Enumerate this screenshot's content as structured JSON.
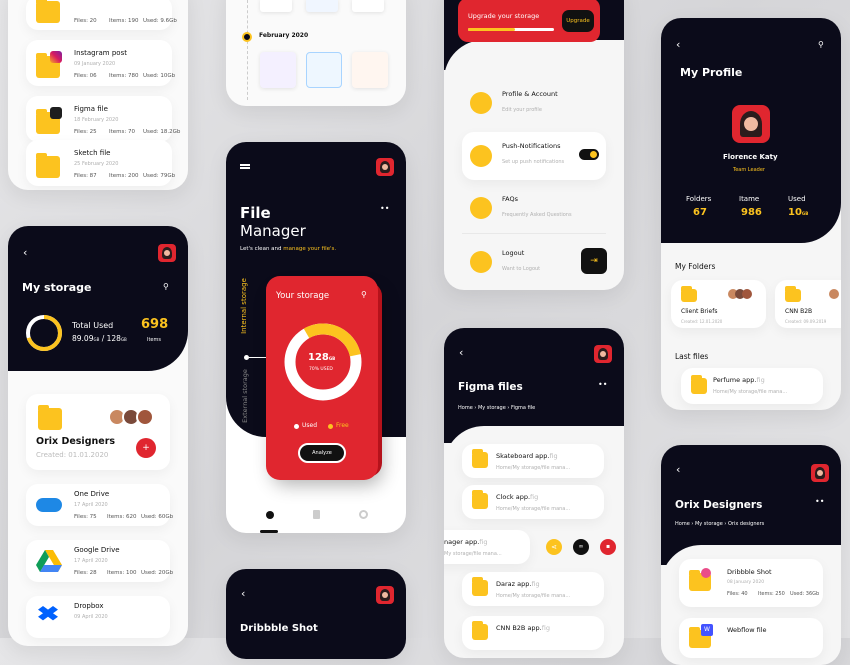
{
  "storage_list": {
    "items": [
      {
        "files": "Files: 20",
        "items": "Items: 190",
        "used": "Used: 9.6Gb"
      },
      {
        "name": "Instagram post",
        "date": "09 January 2020",
        "files": "Files: 06",
        "items": "Items: 780",
        "used": "Used: 10Gb"
      },
      {
        "name": "Figma file",
        "date": "18 February 2020",
        "files": "Files: 25",
        "items": "Items: 70",
        "used": "Used: 18.2Gb"
      },
      {
        "name": "Sketch file",
        "date": "25 February 2020",
        "files": "Files: 87",
        "items": "Items: 200",
        "used": "Used: 79Gb"
      }
    ]
  },
  "timeline": {
    "month": "February 2020"
  },
  "my_storage": {
    "title": "My storage",
    "used_label": "Total Used",
    "used_value": "89.09",
    "used_unit": "GB",
    "total_value": "128",
    "items_count": "698",
    "items_label": "Items",
    "used_fraction": 0.7,
    "group_name": "Orix Designers",
    "group_created": "Created: 01.01.2020",
    "add_label": "+",
    "services": [
      {
        "name": "One Drive",
        "date": "17 April 2020",
        "files": "Files: 75",
        "items": "Items: 620",
        "used": "Used: 60Gb"
      },
      {
        "name": "Google Drive",
        "date": "17 April 2020",
        "files": "Files: 28",
        "items": "Items: 100",
        "used": "Used: 20Gb"
      },
      {
        "name": "Dropbox",
        "date": "09 April 2020"
      }
    ]
  },
  "file_manager": {
    "title1": "File",
    "title2": "Manager",
    "sub1": "Let's clean and ",
    "sub2": "manage your file's.",
    "side_internal": "Internal storage",
    "side_external": "External storage",
    "card_title": "Your storage",
    "amount": "128",
    "amount_unit": "GB",
    "percent": "70% USED",
    "used_fraction": 0.7,
    "legend_used": "Used",
    "legend_free": "Free",
    "analyze": "Analyze",
    "more": "••"
  },
  "dribbble": {
    "title": "Dribbble Shot"
  },
  "settings": {
    "upgrade": "Upgrade your storage",
    "upgrade_btn": "Upgrade",
    "upgrade_fraction": 0.55,
    "items": [
      {
        "title": "Profile & Account",
        "sub": "Edit your profile"
      },
      {
        "title": "Push-Notifications",
        "sub": "Set up push notifications"
      },
      {
        "title": "FAQs",
        "sub": "Frequently Asked Questions"
      },
      {
        "title": "Logout",
        "sub": "Want to Logout"
      }
    ]
  },
  "figma": {
    "title": "Figma files",
    "breadcrumb": "Home › My storage › Figma file",
    "files": [
      {
        "name": "Skateboard app.",
        "ext": "fig",
        "path": "Home/My storage/file mana..."
      },
      {
        "name": "Clock app.",
        "ext": "fig",
        "path": "Home/My storage/file mana..."
      },
      {
        "name": "nager app.",
        "ext": "fig",
        "path": "My storage/file mana..."
      },
      {
        "name": "Daraz app.",
        "ext": "fig",
        "path": "Home/My storage/file mana..."
      },
      {
        "name": "CNN B2B app.",
        "ext": "fig",
        "path": ""
      }
    ]
  },
  "profile": {
    "title": "My Profile",
    "name": "Florence Katy",
    "role": "Team Leader",
    "stats": [
      {
        "label": "Folders",
        "value": "67",
        "unit": ""
      },
      {
        "label": "Itame",
        "value": "986",
        "unit": ""
      },
      {
        "label": "Used",
        "value": "10",
        "unit": "GB"
      }
    ],
    "folders_title": "My Folders",
    "folders": [
      {
        "name": "Client Briefs",
        "date": "Created: 12.01.2020"
      },
      {
        "name": "CNN B2B",
        "date": "Created: 09.09.2019"
      }
    ],
    "last_title": "Last files",
    "last_file": {
      "name": "Perfume app.",
      "ext": "fig",
      "path": "Home/My storage/file mana..."
    }
  },
  "orix": {
    "title": "Orix Designers",
    "breadcrumb": "Home › My storage › Orix designers",
    "files": [
      {
        "name": "Dribbble Shot",
        "date": "08 January 2020",
        "files": "Files: 40",
        "items": "Items: 250",
        "used": "Used: 36Gb"
      },
      {
        "name": "Webflow file"
      }
    ]
  },
  "colors": {
    "accent": "#fcc31f",
    "red": "#e0262f",
    "dark": "#0b0b1a"
  }
}
